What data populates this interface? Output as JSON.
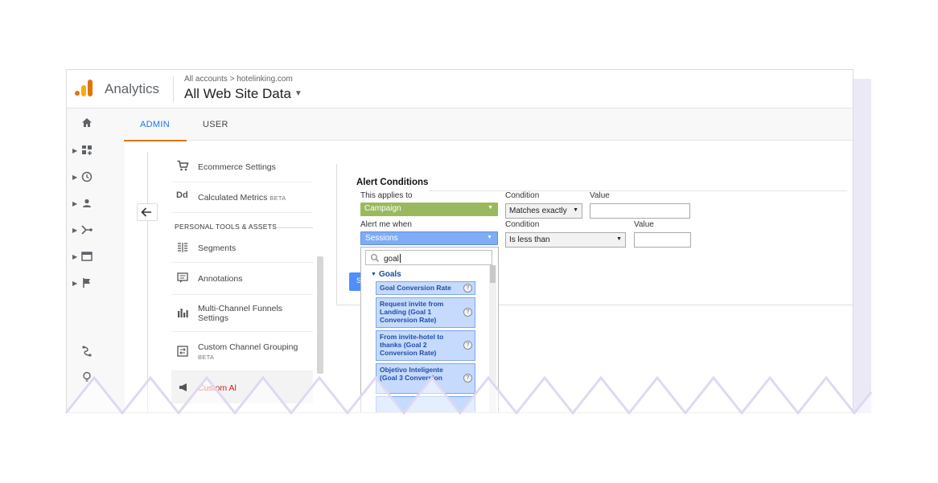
{
  "header": {
    "app_title": "Analytics",
    "breadcrumb": "All accounts > hotelinking.com",
    "property": "All Web Site Data"
  },
  "tabs": [
    {
      "label": "ADMIN",
      "active": true
    },
    {
      "label": "USER",
      "active": false
    }
  ],
  "admin_menu": {
    "ecommerce": "Ecommerce Settings",
    "calculated_metrics": "Calculated Metrics",
    "beta": "BETA",
    "section_title": "PERSONAL TOOLS & ASSETS",
    "segments": "Segments",
    "annotations": "Annotations",
    "mcf": "Multi-Channel Funnels Settings",
    "channel_grouping": "Custom Channel Grouping",
    "custom_alerts": "Custom Al"
  },
  "alert": {
    "title": "Alert Conditions",
    "applies_to_label": "This applies to",
    "applies_to_value": "Campaign",
    "condition_label": "Condition",
    "condition1_value": "Matches exactly",
    "value_label": "Value",
    "alert_when_label": "Alert me when",
    "alert_when_value": "Sessions",
    "condition2_value": "Is less than",
    "save_partial": "S"
  },
  "popup": {
    "search_value": "goal",
    "group": "Goals",
    "options": [
      "Goal Conversion Rate",
      "Request invite from Landing (Goal 1 Conversion Rate)",
      "From invite-hotel to thanks (Goal 2 Conversion Rate)",
      "Objetivo Inteligente (Goal 3 Conversion"
    ],
    "help_glyph": "?"
  },
  "colors": {
    "accent_blue": "#1a73e8",
    "tab_underline": "#e37400",
    "green_dropdown": "#9ab95e",
    "blue_dropdown": "#7facf5",
    "zigzag_stroke": "#ded9f2"
  }
}
